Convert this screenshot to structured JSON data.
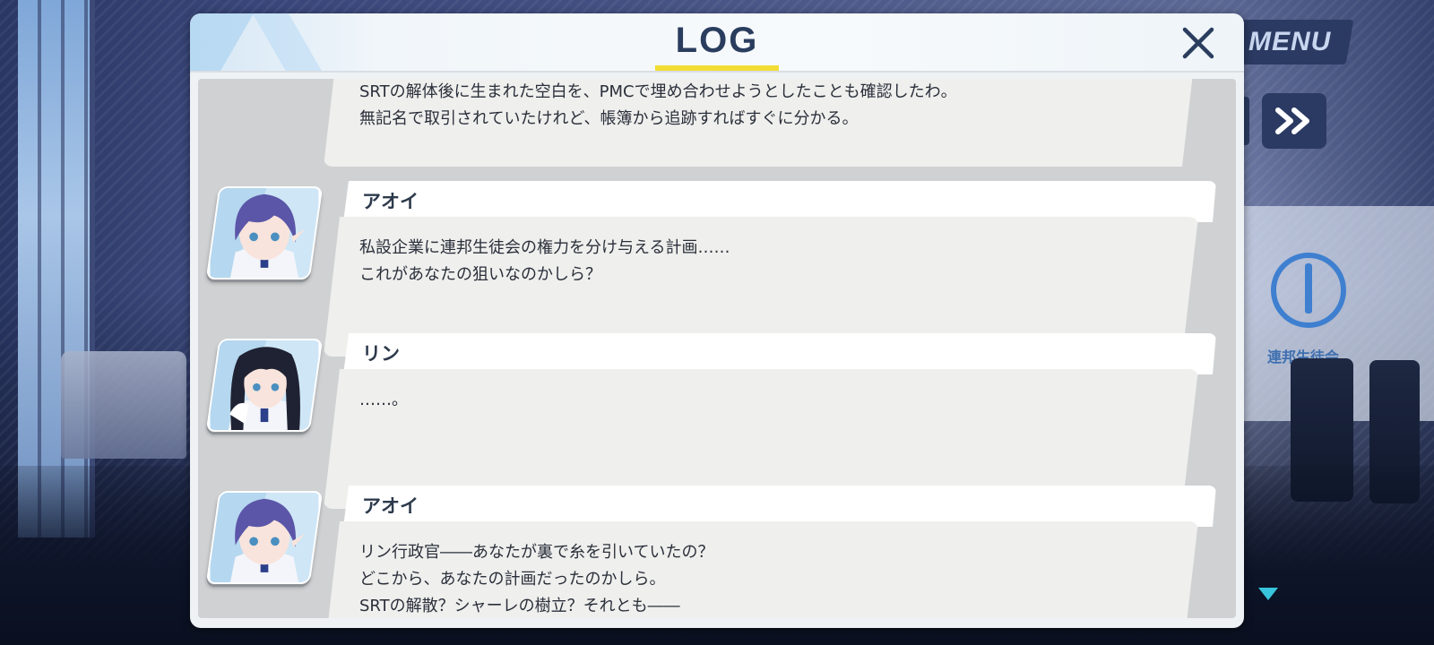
{
  "hud": {
    "menu_label": "MENU",
    "fast_forward_icon": "fast-forward-icon",
    "scroll_indicator_icon": "down-triangle-icon"
  },
  "log": {
    "title": "LOG",
    "close_icon": "close-icon",
    "accent_color": "#f2dd35",
    "entries": [
      {
        "speaker": "",
        "character": "aoi",
        "lines": [
          "SRTの解体後に生まれた空白を、PMCで埋め合わせようとしたことも確認したわ。",
          "無記名で取引されていたけれど、帳簿から追跡すればすぐに分かる。"
        ]
      },
      {
        "speaker": "アオイ",
        "character": "aoi",
        "lines": [
          "私設企業に連邦生徒会の権力を分け与える計画……",
          "これがあなたの狙いなのかしら？"
        ]
      },
      {
        "speaker": "リン",
        "character": "rin",
        "lines": [
          "……。"
        ]
      },
      {
        "speaker": "アオイ",
        "character": "aoi",
        "lines": [
          "リン行政官――あなたが裏で糸を引いていたの？",
          "どこから、あなたの計画だったのかしら。",
          "SRTの解散？シャーレの樹立？それとも――"
        ]
      }
    ]
  },
  "background": {
    "emblem_text": "連邦生徒会"
  }
}
